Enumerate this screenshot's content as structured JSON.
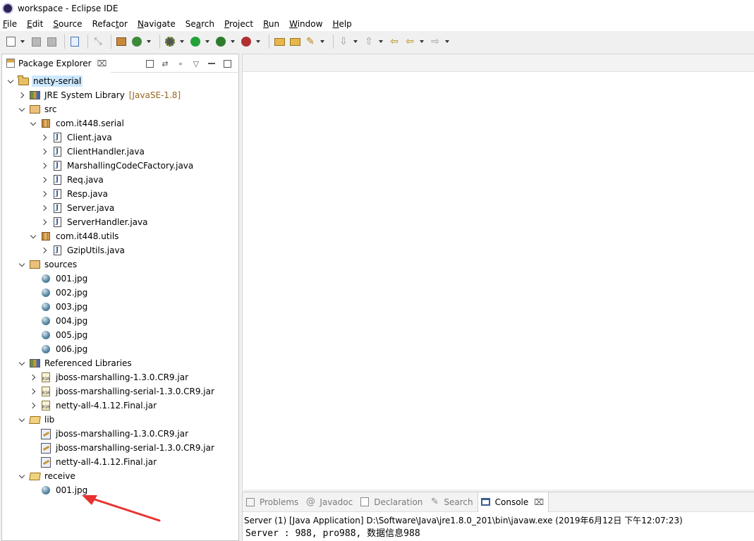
{
  "window": {
    "title": "workspace - Eclipse IDE"
  },
  "menubar": [
    {
      "label": "File",
      "mnemonic": "F",
      "rest": "ile"
    },
    {
      "label": "Edit",
      "mnemonic": "E",
      "rest": "dit"
    },
    {
      "label": "Source",
      "mnemonic": "S",
      "rest": "ource"
    },
    {
      "label": "Refactor",
      "mnemonic": "",
      "rest": "Refac",
      "mn2": "t",
      "rest2": "or"
    },
    {
      "label": "Navigate",
      "mnemonic": "N",
      "rest": "avigate"
    },
    {
      "label": "Search",
      "mnemonic": "",
      "rest": "Se",
      "mn2": "a",
      "rest2": "rch"
    },
    {
      "label": "Project",
      "mnemonic": "P",
      "rest": "roject"
    },
    {
      "label": "Run",
      "mnemonic": "R",
      "rest": "un"
    },
    {
      "label": "Window",
      "mnemonic": "W",
      "rest": "indow"
    },
    {
      "label": "Help",
      "mnemonic": "H",
      "rest": "elp"
    }
  ],
  "explorer": {
    "tab_label": "Package Explorer",
    "tab_close": "⌧",
    "tree": [
      {
        "label": "netty-serial",
        "depth": 0,
        "state": "open",
        "icon": "project-icon",
        "selected": true
      },
      {
        "label": "JRE System Library",
        "decor": "[JavaSE-1.8]",
        "depth": 1,
        "state": "closed",
        "icon": "jre-library-icon"
      },
      {
        "label": "src",
        "depth": 1,
        "state": "open",
        "icon": "source-folder-icon"
      },
      {
        "label": "com.it448.serial",
        "depth": 2,
        "state": "open",
        "icon": "package-icon"
      },
      {
        "label": "Client.java",
        "depth": 3,
        "state": "closed",
        "icon": "java-file-icon"
      },
      {
        "label": "ClientHandler.java",
        "depth": 3,
        "state": "closed",
        "icon": "java-file-icon"
      },
      {
        "label": "MarshallingCodeCFactory.java",
        "depth": 3,
        "state": "closed",
        "icon": "java-file-icon"
      },
      {
        "label": "Req.java",
        "depth": 3,
        "state": "closed",
        "icon": "java-file-icon"
      },
      {
        "label": "Resp.java",
        "depth": 3,
        "state": "closed",
        "icon": "java-file-icon"
      },
      {
        "label": "Server.java",
        "depth": 3,
        "state": "closed",
        "icon": "java-file-icon"
      },
      {
        "label": "ServerHandler.java",
        "depth": 3,
        "state": "closed",
        "icon": "java-file-icon"
      },
      {
        "label": "com.it448.utils",
        "depth": 2,
        "state": "open",
        "icon": "package-icon"
      },
      {
        "label": "GzipUtils.java",
        "depth": 3,
        "state": "closed",
        "icon": "java-file-icon"
      },
      {
        "label": "sources",
        "depth": 1,
        "state": "open",
        "icon": "source-folder-icon"
      },
      {
        "label": "001.jpg",
        "depth": 2,
        "state": "none",
        "icon": "image-file-icon"
      },
      {
        "label": "002.jpg",
        "depth": 2,
        "state": "none",
        "icon": "image-file-icon"
      },
      {
        "label": "003.jpg",
        "depth": 2,
        "state": "none",
        "icon": "image-file-icon"
      },
      {
        "label": "004.jpg",
        "depth": 2,
        "state": "none",
        "icon": "image-file-icon"
      },
      {
        "label": "005.jpg",
        "depth": 2,
        "state": "none",
        "icon": "image-file-icon"
      },
      {
        "label": "006.jpg",
        "depth": 2,
        "state": "none",
        "icon": "image-file-icon"
      },
      {
        "label": "Referenced Libraries",
        "depth": 1,
        "state": "open",
        "icon": "library-icon"
      },
      {
        "label": "jboss-marshalling-1.3.0.CR9.jar",
        "depth": 2,
        "state": "closed",
        "icon": "jar-icon"
      },
      {
        "label": "jboss-marshalling-serial-1.3.0.CR9.jar",
        "depth": 2,
        "state": "closed",
        "icon": "jar-icon"
      },
      {
        "label": "netty-all-4.1.12.Final.jar",
        "depth": 2,
        "state": "closed",
        "icon": "jar-icon"
      },
      {
        "label": "lib",
        "depth": 1,
        "state": "open",
        "icon": "folder-icon"
      },
      {
        "label": "jboss-marshalling-1.3.0.CR9.jar",
        "depth": 2,
        "state": "none",
        "icon": "jar-file-icon"
      },
      {
        "label": "jboss-marshalling-serial-1.3.0.CR9.jar",
        "depth": 2,
        "state": "none",
        "icon": "jar-file-icon"
      },
      {
        "label": "netty-all-4.1.12.Final.jar",
        "depth": 2,
        "state": "none",
        "icon": "jar-file-icon"
      },
      {
        "label": "receive",
        "depth": 1,
        "state": "open",
        "icon": "folder-icon"
      },
      {
        "label": "001.jpg",
        "depth": 2,
        "state": "none",
        "icon": "image-file-icon"
      }
    ]
  },
  "bottom_panel": {
    "tabs": [
      {
        "label": "Problems",
        "icon": "problems-icon",
        "active": false
      },
      {
        "label": "Javadoc",
        "icon": "at-sign-icon",
        "active": false
      },
      {
        "label": "Declaration",
        "icon": "declaration-icon",
        "active": false
      },
      {
        "label": "Search",
        "icon": "search-icon",
        "active": false
      },
      {
        "label": "Console",
        "icon": "console-icon",
        "active": true
      }
    ],
    "console_close": "⌧",
    "console_header": "Server (1) [Java Application] D:\\Software\\Java\\jre1.8.0_201\\bin\\javaw.exe (2019年6月12日 下午12:07:23)",
    "console_line": "Server : 988, pro988, 数据信息988"
  },
  "colors": {
    "selection": "#cce8ff",
    "annotation_arrow": "#e8322f",
    "library_decoration": "#95671f"
  }
}
